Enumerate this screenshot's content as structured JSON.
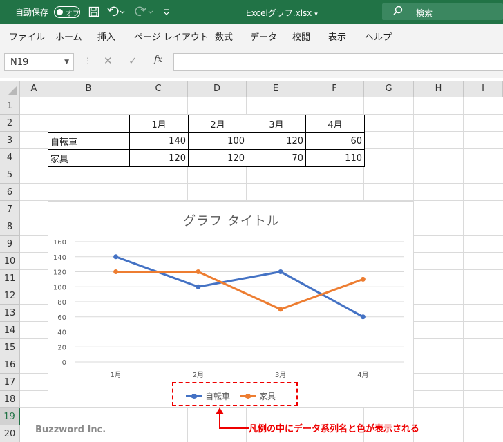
{
  "titlebar": {
    "autosave": "自動保存",
    "toggle": "オフ",
    "filename": "Excelグラフ.xlsx",
    "search": "検索"
  },
  "menu": [
    "ファイル",
    "ホーム",
    "挿入",
    "ページ レイアウト",
    "数式",
    "データ",
    "校閲",
    "表示",
    "ヘルプ"
  ],
  "formula_bar": {
    "name_box": "N19",
    "fx": "fx",
    "value": ""
  },
  "columns": [
    "A",
    "B",
    "C",
    "D",
    "E",
    "F",
    "G",
    "H",
    "I"
  ],
  "rows": [
    "1",
    "2",
    "3",
    "4",
    "5",
    "6",
    "7",
    "8",
    "9",
    "10",
    "11",
    "12",
    "13",
    "14",
    "15",
    "16",
    "17",
    "18",
    "19",
    "20"
  ],
  "selected_row": "19",
  "table": {
    "header": [
      "",
      "1月",
      "2月",
      "3月",
      "4月"
    ],
    "rows": [
      [
        "自転車",
        "140",
        "100",
        "120",
        "60"
      ],
      [
        "家具",
        "120",
        "120",
        "70",
        "110"
      ]
    ]
  },
  "chart_data": {
    "type": "line",
    "title": "グラフ タイトル",
    "categories": [
      "1月",
      "2月",
      "3月",
      "4月"
    ],
    "series": [
      {
        "name": "自転車",
        "values": [
          140,
          100,
          120,
          60
        ],
        "color": "#4472c4"
      },
      {
        "name": "家具",
        "values": [
          120,
          120,
          70,
          110
        ],
        "color": "#ed7d31"
      }
    ],
    "yticks": [
      "0",
      "20",
      "40",
      "60",
      "80",
      "100",
      "120",
      "140",
      "160"
    ],
    "ylim": [
      0,
      160
    ],
    "grid": true,
    "legend": "bottom"
  },
  "annotation": "凡例の中にデータ系列名と色が表示される",
  "watermark": "Buzzword Inc.",
  "colors": {
    "excel_green": "#217346",
    "annotation_red": "#ee0000"
  }
}
